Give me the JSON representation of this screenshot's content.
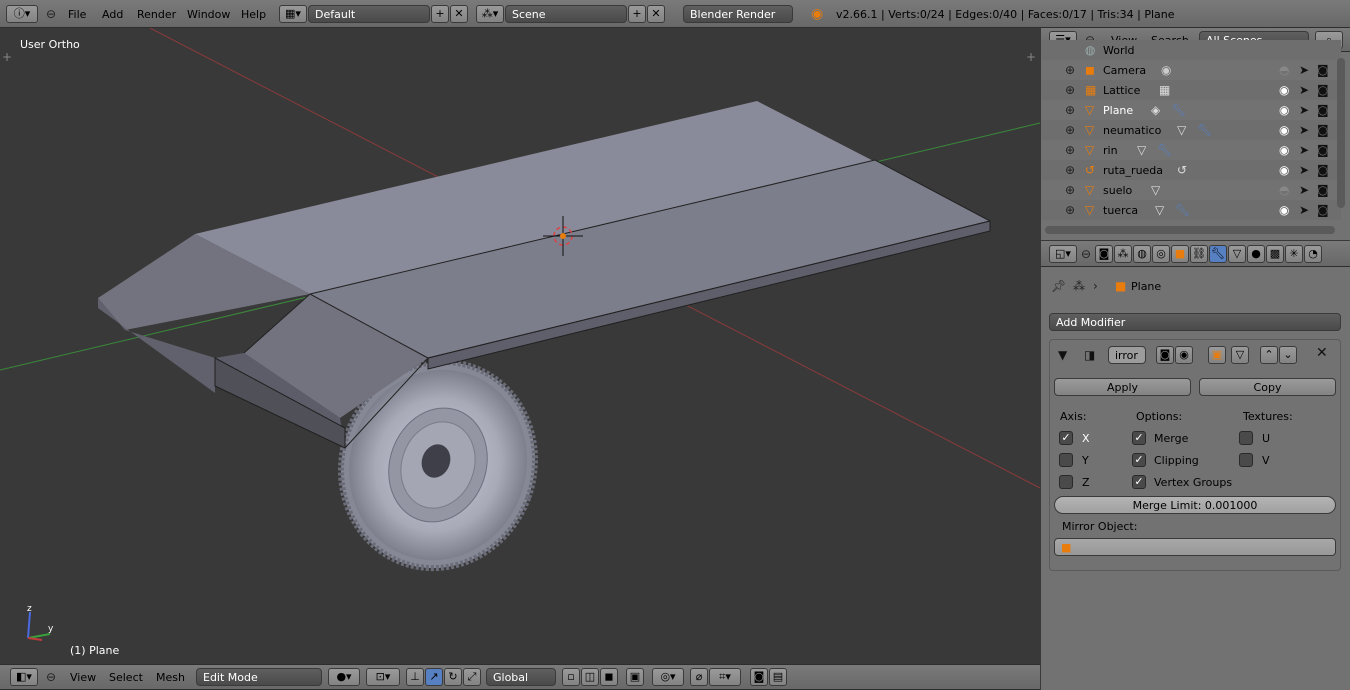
{
  "topbar": {
    "menus": [
      "File",
      "Add",
      "Render",
      "Window",
      "Help"
    ],
    "layout": "Default",
    "scene": "Scene",
    "engine": "Blender Render",
    "stats": "v2.66.1 | Verts:0/24 | Edges:0/40 | Faces:0/17 | Tris:34 | Plane"
  },
  "viewport": {
    "view_name": "User Ortho",
    "object_label": "(1) Plane"
  },
  "bottombar": {
    "menus": [
      "View",
      "Select",
      "Mesh"
    ],
    "mode": "Edit Mode",
    "orientation": "Global"
  },
  "outliner": {
    "menus": [
      "View",
      "Search"
    ],
    "filter": "All Scenes",
    "items": [
      {
        "name": "World",
        "icon": "world-icon"
      },
      {
        "name": "Camera",
        "icon": "camera-icon"
      },
      {
        "name": "Lattice",
        "icon": "lattice-icon"
      },
      {
        "name": "Plane",
        "icon": "mesh-icon"
      },
      {
        "name": "neumatico",
        "icon": "mesh-icon"
      },
      {
        "name": "rin",
        "icon": "mesh-icon"
      },
      {
        "name": "ruta_rueda",
        "icon": "curve-icon"
      },
      {
        "name": "suelo",
        "icon": "mesh-icon"
      },
      {
        "name": "tuerca",
        "icon": "mesh-icon"
      }
    ]
  },
  "properties": {
    "object_name": "Plane",
    "add_modifier": "Add Modifier",
    "modifier": {
      "name": "irror",
      "apply": "Apply",
      "copy": "Copy",
      "axis_label": "Axis:",
      "options_label": "Options:",
      "textures_label": "Textures:",
      "axis": [
        {
          "label": "X",
          "checked": true
        },
        {
          "label": "Y",
          "checked": false
        },
        {
          "label": "Z",
          "checked": false
        }
      ],
      "options": [
        {
          "label": "Merge",
          "checked": true
        },
        {
          "label": "Clipping",
          "checked": true
        },
        {
          "label": "Vertex Groups",
          "checked": true
        }
      ],
      "textures": [
        {
          "label": "U",
          "checked": false
        },
        {
          "label": "V",
          "checked": false
        }
      ],
      "merge_limit": "Merge Limit: 0.001000",
      "mirror_object_label": "Mirror Object:"
    }
  },
  "colors": {
    "accent_orange": "#e87d0d",
    "panel_bg": "#727272",
    "viewport_bg": "#393939",
    "selected_blue": "#5680c2"
  }
}
